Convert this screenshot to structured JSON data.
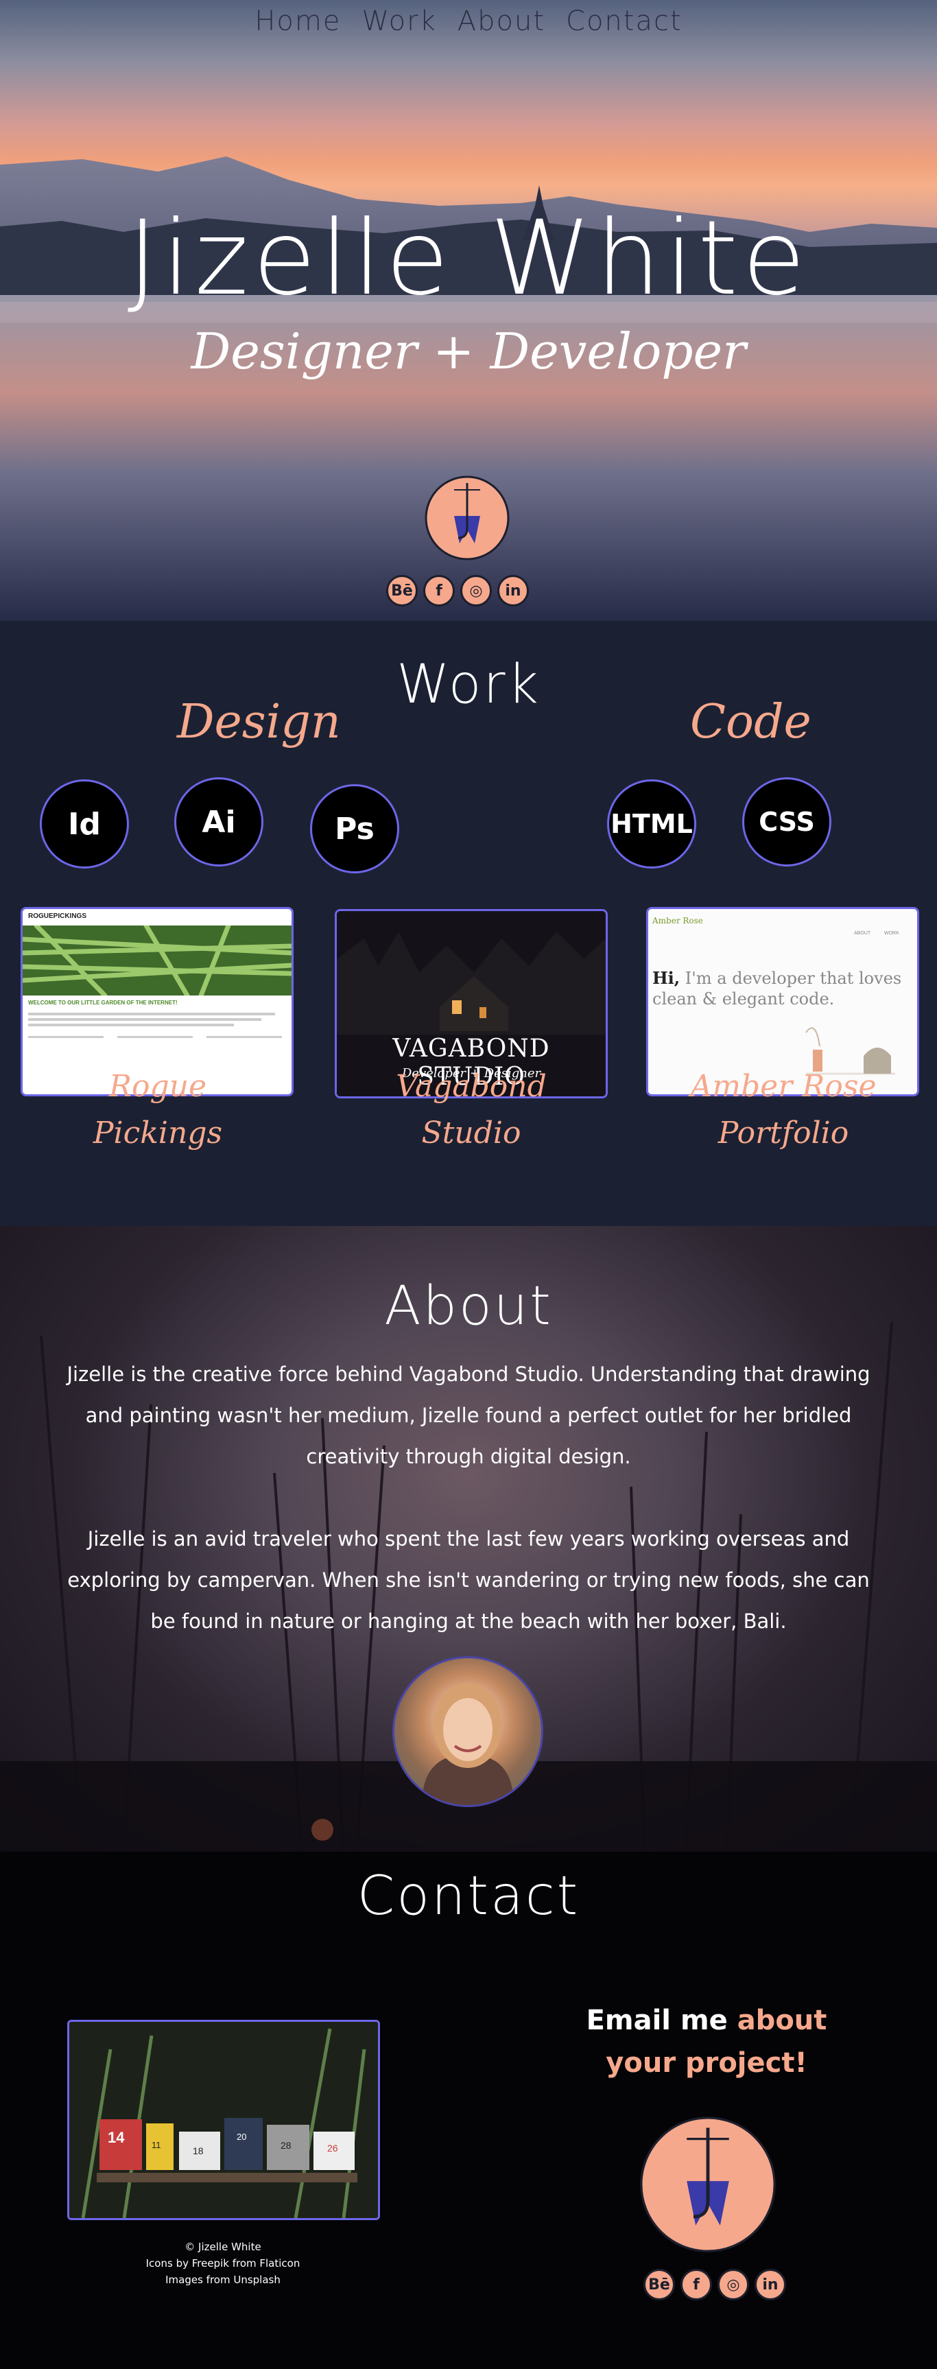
{
  "nav": {
    "home": "Home",
    "work": "Work",
    "about": "About",
    "contact": "Contact"
  },
  "hero": {
    "title": "Jizelle White",
    "subtitle": "Designer + Developer"
  },
  "socials": [
    "Bē",
    "f",
    "◎",
    "in"
  ],
  "work": {
    "title": "Work",
    "design_label": "Design",
    "code_label": "Code",
    "design_skills": [
      "Id",
      "Ai",
      "Ps"
    ],
    "code_skills": [
      "HTML",
      "CSS"
    ],
    "projects": [
      {
        "line1": "Rogue",
        "line2": "Pickings"
      },
      {
        "line1": "Vagabond",
        "line2": "Studio"
      },
      {
        "line1": "Amber Rose",
        "line2": "Portfolio"
      }
    ],
    "rogue_site": {
      "brand": "ROGUEPICKINGS",
      "welcome": "WELCOME TO OUR LITTLE GARDEN OF THE INTERNET!"
    },
    "vagabond_site": {
      "title": "VAGABOND STUDIO",
      "sub": "Developer + Designer"
    },
    "amber_site": {
      "brand": "Amber Rose",
      "about": "ABOUT",
      "work": "WORK",
      "headline_hi": "Hi,",
      "headline_rest": "I'm a developer that loves clean & elegant code."
    }
  },
  "about": {
    "title": "About",
    "p1": "Jizelle is the creative force behind Vagabond Studio. Understanding that drawing and painting wasn't her medium, Jizelle found a perfect outlet for her bridled creativity through digital design.",
    "p2": "Jizelle is an avid traveler who spent the last few years working overseas and exploring by campervan. When she isn't wandering or trying new foods, she can be found in nature or hanging at the beach with her boxer, Bali."
  },
  "contact": {
    "title": "Contact",
    "email_prefix": "Email me",
    "email_highlight_1": "about",
    "email_highlight_2": "your project!",
    "credit_1": "© Jizelle White",
    "credit_2": "Icons by Freepik from Flaticon",
    "credit_3": "Images from Unsplash",
    "mailbox_numbers": [
      "14",
      "11",
      "18",
      "20",
      "28",
      "26"
    ]
  },
  "colors": {
    "accent": "#f6a88c",
    "border": "#6d66e8",
    "work_bg": "#1b2133",
    "logo_blue": "#3a3aa8"
  }
}
